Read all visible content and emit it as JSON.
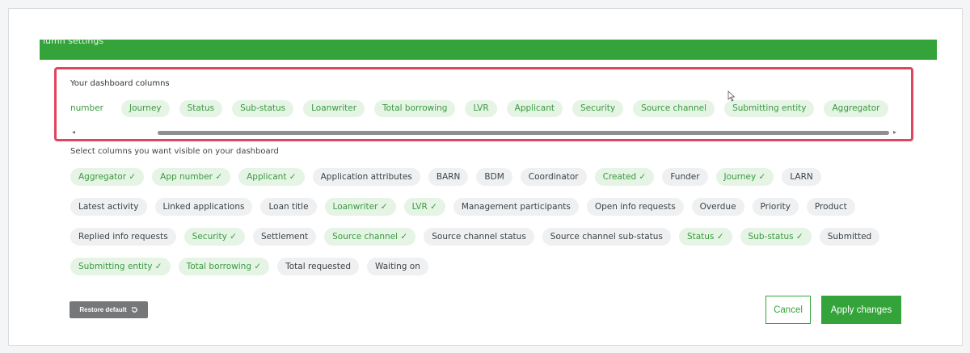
{
  "header": {
    "title": "lumn settings"
  },
  "dashboard": {
    "title": "Your dashboard columns",
    "columns": [
      "number",
      "Journey",
      "Status",
      "Sub-status",
      "Loanwriter",
      "Total borrowing",
      "LVR",
      "Applicant",
      "Security",
      "Source channel",
      "Submitting entity",
      "Aggregator"
    ]
  },
  "select": {
    "instruction": "Select columns you want visible on your dashboard",
    "rows": [
      [
        {
          "label": "Aggregator ✓",
          "selected": true
        },
        {
          "label": "App number ✓",
          "selected": true
        },
        {
          "label": "Applicant ✓",
          "selected": true
        },
        {
          "label": "Application attributes",
          "selected": false
        },
        {
          "label": "BARN",
          "selected": false
        },
        {
          "label": "BDM",
          "selected": false
        },
        {
          "label": "Coordinator",
          "selected": false
        },
        {
          "label": "Created ✓",
          "selected": true
        },
        {
          "label": "Funder",
          "selected": false
        },
        {
          "label": "Journey ✓",
          "selected": true
        },
        {
          "label": "LARN",
          "selected": false
        }
      ],
      [
        {
          "label": "Latest activity",
          "selected": false
        },
        {
          "label": "Linked applications",
          "selected": false
        },
        {
          "label": "Loan title",
          "selected": false
        },
        {
          "label": "Loanwriter ✓",
          "selected": true
        },
        {
          "label": "LVR ✓",
          "selected": true
        },
        {
          "label": "Management participants",
          "selected": false
        },
        {
          "label": "Open info requests",
          "selected": false
        },
        {
          "label": "Overdue",
          "selected": false
        },
        {
          "label": "Priority",
          "selected": false
        },
        {
          "label": "Product",
          "selected": false
        }
      ],
      [
        {
          "label": "Replied info requests",
          "selected": false
        },
        {
          "label": "Security ✓",
          "selected": true
        },
        {
          "label": "Settlement",
          "selected": false
        },
        {
          "label": "Source channel ✓",
          "selected": true
        },
        {
          "label": "Source channel status",
          "selected": false
        },
        {
          "label": "Source channel sub-status",
          "selected": false
        },
        {
          "label": "Status ✓",
          "selected": true
        },
        {
          "label": "Sub-status ✓",
          "selected": true
        },
        {
          "label": "Submitted",
          "selected": false
        }
      ],
      [
        {
          "label": "Submitting entity ✓",
          "selected": true
        },
        {
          "label": "Total borrowing ✓",
          "selected": true
        },
        {
          "label": "Total requested",
          "selected": false
        },
        {
          "label": "Waiting on",
          "selected": false
        }
      ]
    ]
  },
  "buttons": {
    "restore": "Restore default",
    "restore_icon": "refresh-icon",
    "cancel": "Cancel",
    "apply": "Apply changes"
  },
  "colors": {
    "primary_green": "#34a43a",
    "highlight_red": "#e0445e",
    "chip_green_bg": "#e5f4e5",
    "chip_grey_bg": "#eef0f1"
  }
}
